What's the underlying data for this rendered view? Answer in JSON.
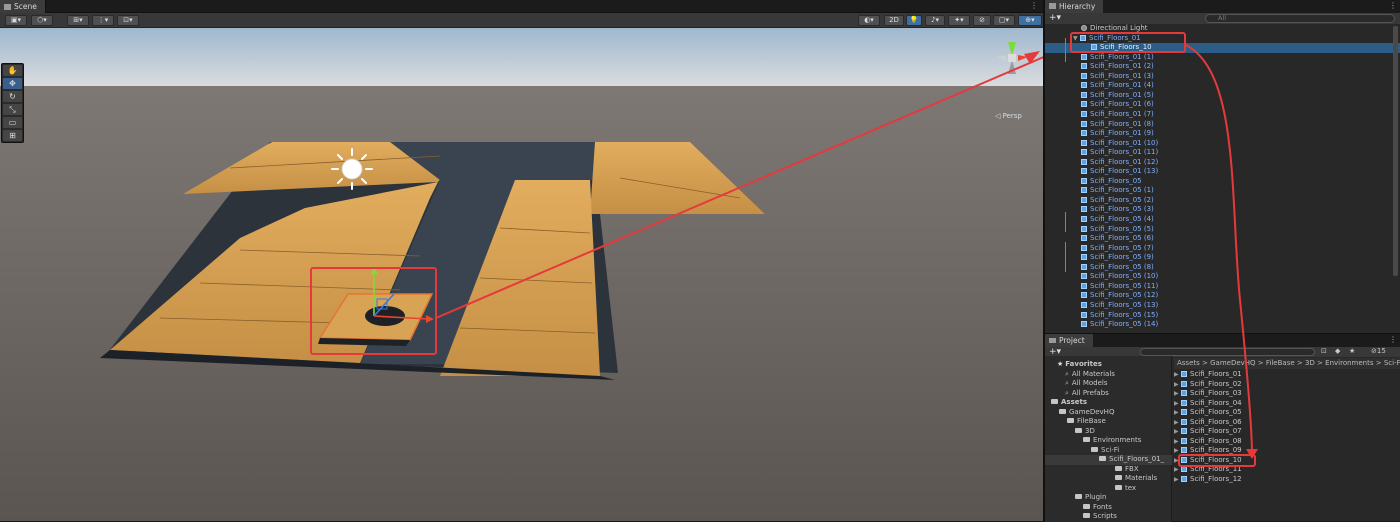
{
  "scene": {
    "tab_label": "Scene",
    "toolbar": {
      "mode_2d": "2D"
    },
    "persp_label": "◁ Persp",
    "tools": [
      "hand-tool",
      "move-tool",
      "rotate-tool",
      "scale-tool",
      "rect-tool",
      "transform-tool"
    ]
  },
  "hierarchy": {
    "tab_label": "Hierarchy",
    "search_placeholder": "All",
    "items": [
      {
        "label": "Directional Light",
        "type": "light"
      },
      {
        "label": "Scifi_Floors_01",
        "type": "prefab",
        "expanded": true
      },
      {
        "label": "Scifi_Floors_10",
        "type": "prefab",
        "child": true,
        "selected": true
      },
      {
        "label": "Scifi_Floors_01 (1)",
        "type": "prefab"
      },
      {
        "label": "Scifi_Floors_01 (2)",
        "type": "prefab"
      },
      {
        "label": "Scifi_Floors_01 (3)",
        "type": "prefab"
      },
      {
        "label": "Scifi_Floors_01 (4)",
        "type": "prefab"
      },
      {
        "label": "Scifi_Floors_01 (5)",
        "type": "prefab"
      },
      {
        "label": "Scifi_Floors_01 (6)",
        "type": "prefab"
      },
      {
        "label": "Scifi_Floors_01 (7)",
        "type": "prefab"
      },
      {
        "label": "Scifi_Floors_01 (8)",
        "type": "prefab"
      },
      {
        "label": "Scifi_Floors_01 (9)",
        "type": "prefab"
      },
      {
        "label": "Scifi_Floors_01 (10)",
        "type": "prefab"
      },
      {
        "label": "Scifi_Floors_01 (11)",
        "type": "prefab"
      },
      {
        "label": "Scifi_Floors_01 (12)",
        "type": "prefab"
      },
      {
        "label": "Scifi_Floors_01 (13)",
        "type": "prefab"
      },
      {
        "label": "Scifi_Floors_05",
        "type": "prefab"
      },
      {
        "label": "Scifi_Floors_05 (1)",
        "type": "prefab"
      },
      {
        "label": "Scifi_Floors_05 (2)",
        "type": "prefab"
      },
      {
        "label": "Scifi_Floors_05 (3)",
        "type": "prefab"
      },
      {
        "label": "Scifi_Floors_05 (4)",
        "type": "prefab"
      },
      {
        "label": "Scifi_Floors_05 (5)",
        "type": "prefab"
      },
      {
        "label": "Scifi_Floors_05 (6)",
        "type": "prefab"
      },
      {
        "label": "Scifi_Floors_05 (7)",
        "type": "prefab"
      },
      {
        "label": "Scifi_Floors_05 (9)",
        "type": "prefab"
      },
      {
        "label": "Scifi_Floors_05 (8)",
        "type": "prefab"
      },
      {
        "label": "Scifi_Floors_05 (10)",
        "type": "prefab"
      },
      {
        "label": "Scifi_Floors_05 (11)",
        "type": "prefab"
      },
      {
        "label": "Scifi_Floors_05 (12)",
        "type": "prefab"
      },
      {
        "label": "Scifi_Floors_05 (13)",
        "type": "prefab"
      },
      {
        "label": "Scifi_Floors_05 (15)",
        "type": "prefab"
      },
      {
        "label": "Scifi_Floors_05 (14)",
        "type": "prefab"
      }
    ]
  },
  "project": {
    "tab_label": "Project",
    "hidden_count": "15",
    "tree": [
      {
        "label": "Favorites",
        "kind": "star",
        "bold": true
      },
      {
        "label": "All Materials",
        "kind": "search"
      },
      {
        "label": "All Models",
        "kind": "search"
      },
      {
        "label": "All Prefabs",
        "kind": "search"
      },
      {
        "label": "Assets",
        "kind": "folder",
        "bold": true
      },
      {
        "label": "GameDevHQ",
        "kind": "folder"
      },
      {
        "label": "FileBase",
        "kind": "folder"
      },
      {
        "label": "3D",
        "kind": "folder"
      },
      {
        "label": "Environments",
        "kind": "folder"
      },
      {
        "label": "Sci-Fi",
        "kind": "folder"
      },
      {
        "label": "Scifi_Floors_01_",
        "kind": "folder",
        "selected": true
      },
      {
        "label": "FBX",
        "kind": "folder"
      },
      {
        "label": "Materials",
        "kind": "folder"
      },
      {
        "label": "tex",
        "kind": "folder"
      },
      {
        "label": "Plugin",
        "kind": "folder"
      },
      {
        "label": "Fonts",
        "kind": "folder"
      },
      {
        "label": "Scripts",
        "kind": "folder"
      }
    ],
    "breadcrumb": [
      "Assets",
      "GameDevHQ",
      "FileBase",
      "3D",
      "Environments",
      "Sci-Fi"
    ],
    "assets": [
      "Scifi_Floors_01",
      "Scifi_Floors_02",
      "Scifi_Floors_03",
      "Scifi_Floors_04",
      "Scifi_Floors_05",
      "Scifi_Floors_06",
      "Scifi_Floors_07",
      "Scifi_Floors_08",
      "Scifi_Floors_09",
      "Scifi_Floors_10",
      "Scifi_Floors_11",
      "Scifi_Floors_12"
    ]
  },
  "colors": {
    "annotation_red": "#e5393b",
    "selection_blue": "#2c5d87",
    "prefab_blue": "#7fb0ff",
    "floor_orange": "#d9a356",
    "floor_dark": "#3a4450"
  }
}
